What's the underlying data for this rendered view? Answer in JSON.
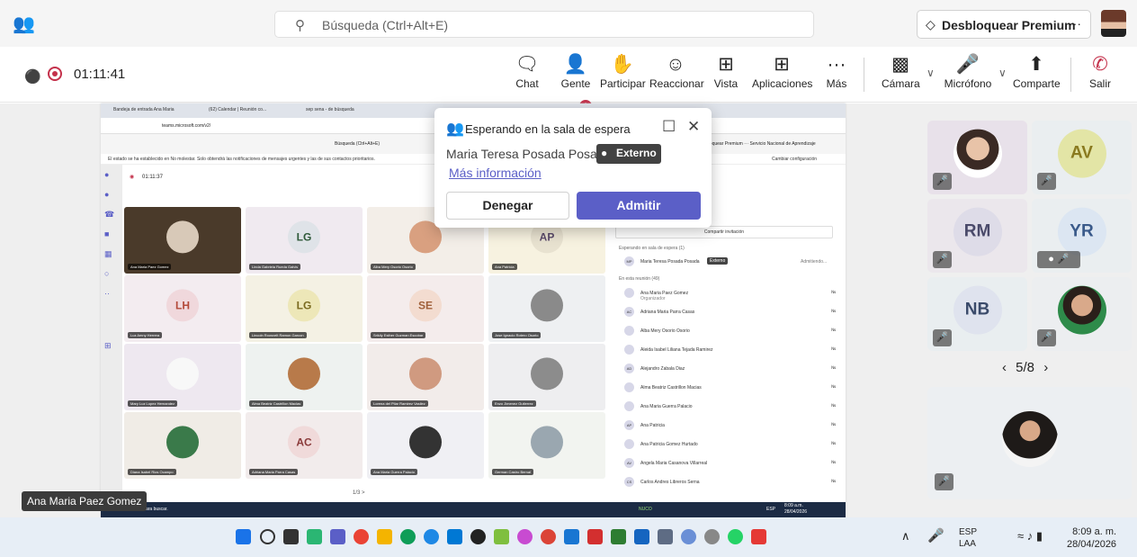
{
  "titlebar": {
    "search_placeholder": "Búsqueda (Ctrl+Alt+E)",
    "premium_label": "Desbloquear Premium",
    "more_label": "···"
  },
  "toolbar": {
    "timer": "01:11:41",
    "chat_badge": "1",
    "buttons": {
      "chat": "Chat",
      "people": "Gente",
      "raise": "Participar",
      "react": "Reaccionar",
      "view": "Vista",
      "apps": "Aplicaciones",
      "more": "Más",
      "camera": "Cámara",
      "mic": "Micrófono",
      "share": "Comparte",
      "leave": "Salir"
    }
  },
  "lobby": {
    "title": "Esperando en la sala de espera",
    "person": "Maria Teresa Posada Posada",
    "external_badge": "Externo",
    "more_info": "Más información",
    "deny": "Denegar",
    "admit": "Admitir"
  },
  "shared_screen": {
    "tabs": [
      "Bandeja de entrada Ana Maria",
      "(62) Calendar | Reunión co...",
      "sep sena - de búsqueda"
    ],
    "address": "teams.microsoft.com/v2/",
    "search": "Búsqueda (Ctrl+Alt+E)",
    "notice": "El estado se ha establecido en No molestar. Solo obtendrá las notificaciones de mensajes urgentes y las de sus contactos prioritarios.",
    "notice_action": "Cambiar configuración",
    "timer": "01:11:37",
    "premium": "Desbloquear Premium ··· Servicio Nacional de Aprendizaje",
    "share_invite": "Compartir invitación",
    "waiting_header": "Esperando en sala de espera (1)",
    "waiting_person": "Maria Teresa Posada Posada",
    "waiting_badge": "Externo",
    "waiting_status": "Admitiendo...",
    "in_meeting_header": "En esta reunión (49)",
    "participants": [
      {
        "initials": "",
        "name": "Ana Maria Paez Gomez",
        "role": "Organizador"
      },
      {
        "initials": "AC",
        "name": "Adriana Maria Parra Casas",
        "role": ""
      },
      {
        "initials": "",
        "name": "Alba Mery Osorio Osorio",
        "role": ""
      },
      {
        "initials": "",
        "name": "Aleida Isabel Liliana Tejada Ramirez",
        "role": ""
      },
      {
        "initials": "AD",
        "name": "Alejandro Zabala Diaz",
        "role": ""
      },
      {
        "initials": "",
        "name": "Alma Beatriz Castrillon Macias",
        "role": ""
      },
      {
        "initials": "",
        "name": "Ana Maria Guerra Palacio",
        "role": ""
      },
      {
        "initials": "AP",
        "name": "Ana Patricia",
        "role": ""
      },
      {
        "initials": "",
        "name": "Ana Patricia Gomez Hurtado",
        "role": ""
      },
      {
        "initials": "AV",
        "name": "Angela Maria Casanova Villarreal",
        "role": ""
      },
      {
        "initials": "CS",
        "name": "Carlos Andres Libreros Serna",
        "role": ""
      }
    ],
    "tiles": [
      {
        "initials": "",
        "name": "Ana Maria Paez Gomez"
      },
      {
        "initials": "LG",
        "name": "Linda Gabriela Rueda Galvis"
      },
      {
        "initials": "",
        "name": "Alba Mery Osorio Osorio"
      },
      {
        "initials": "AP",
        "name": "Ana Patricia"
      },
      {
        "initials": "LH",
        "name": "Luz Amny Herrera"
      },
      {
        "initials": "LG",
        "name": "Lincoln Roosvelt Ramon Garcon"
      },
      {
        "initials": "SE",
        "name": "Srikily Esther Guzman Escobar"
      },
      {
        "initials": "",
        "name": "Jose Ignacio Rotero Osorio"
      },
      {
        "initials": "",
        "name": "Mary Luz Lopez Hernandez"
      },
      {
        "initials": "",
        "name": "Alma Beatriz Castrillon Macias"
      },
      {
        "initials": "",
        "name": "Lorena del Pilar Ramirez Vasilez"
      },
      {
        "initials": "",
        "name": "Enzo Jimenez Gutierrez"
      },
      {
        "initials": "",
        "name": "Diana Isabel Rios Ocampo"
      },
      {
        "initials": "AC",
        "name": "Adriana Maria Parra Casas"
      },
      {
        "initials": "",
        "name": "Ana Maria Guerra Palacio"
      },
      {
        "initials": "",
        "name": "German Castro Bernal"
      }
    ],
    "pager": "1/3 >",
    "taskbar_search": "Escribe aquí para buscar.",
    "taskbar_weather": "NUCO",
    "taskbar_time": "8:09 a.m.",
    "taskbar_date": "28/04/2026",
    "taskbar_lang": "ESP"
  },
  "gallery": {
    "tiles": [
      {
        "initials": ""
      },
      {
        "initials": "AV"
      },
      {
        "initials": "RM"
      },
      {
        "initials": "YR"
      },
      {
        "initials": "NB"
      },
      {
        "initials": ""
      }
    ],
    "pager": "5/8",
    "speaker": "Ana Maria Paez Gomez"
  },
  "taskbar": {
    "lang_top": "ESP",
    "lang_bottom": "LAA",
    "time": "8:09 a. m.",
    "date": "28/04/2026"
  },
  "colors": {
    "accent": "#5b5fc7",
    "leave": "#c4314b",
    "record": "#c4314b"
  }
}
